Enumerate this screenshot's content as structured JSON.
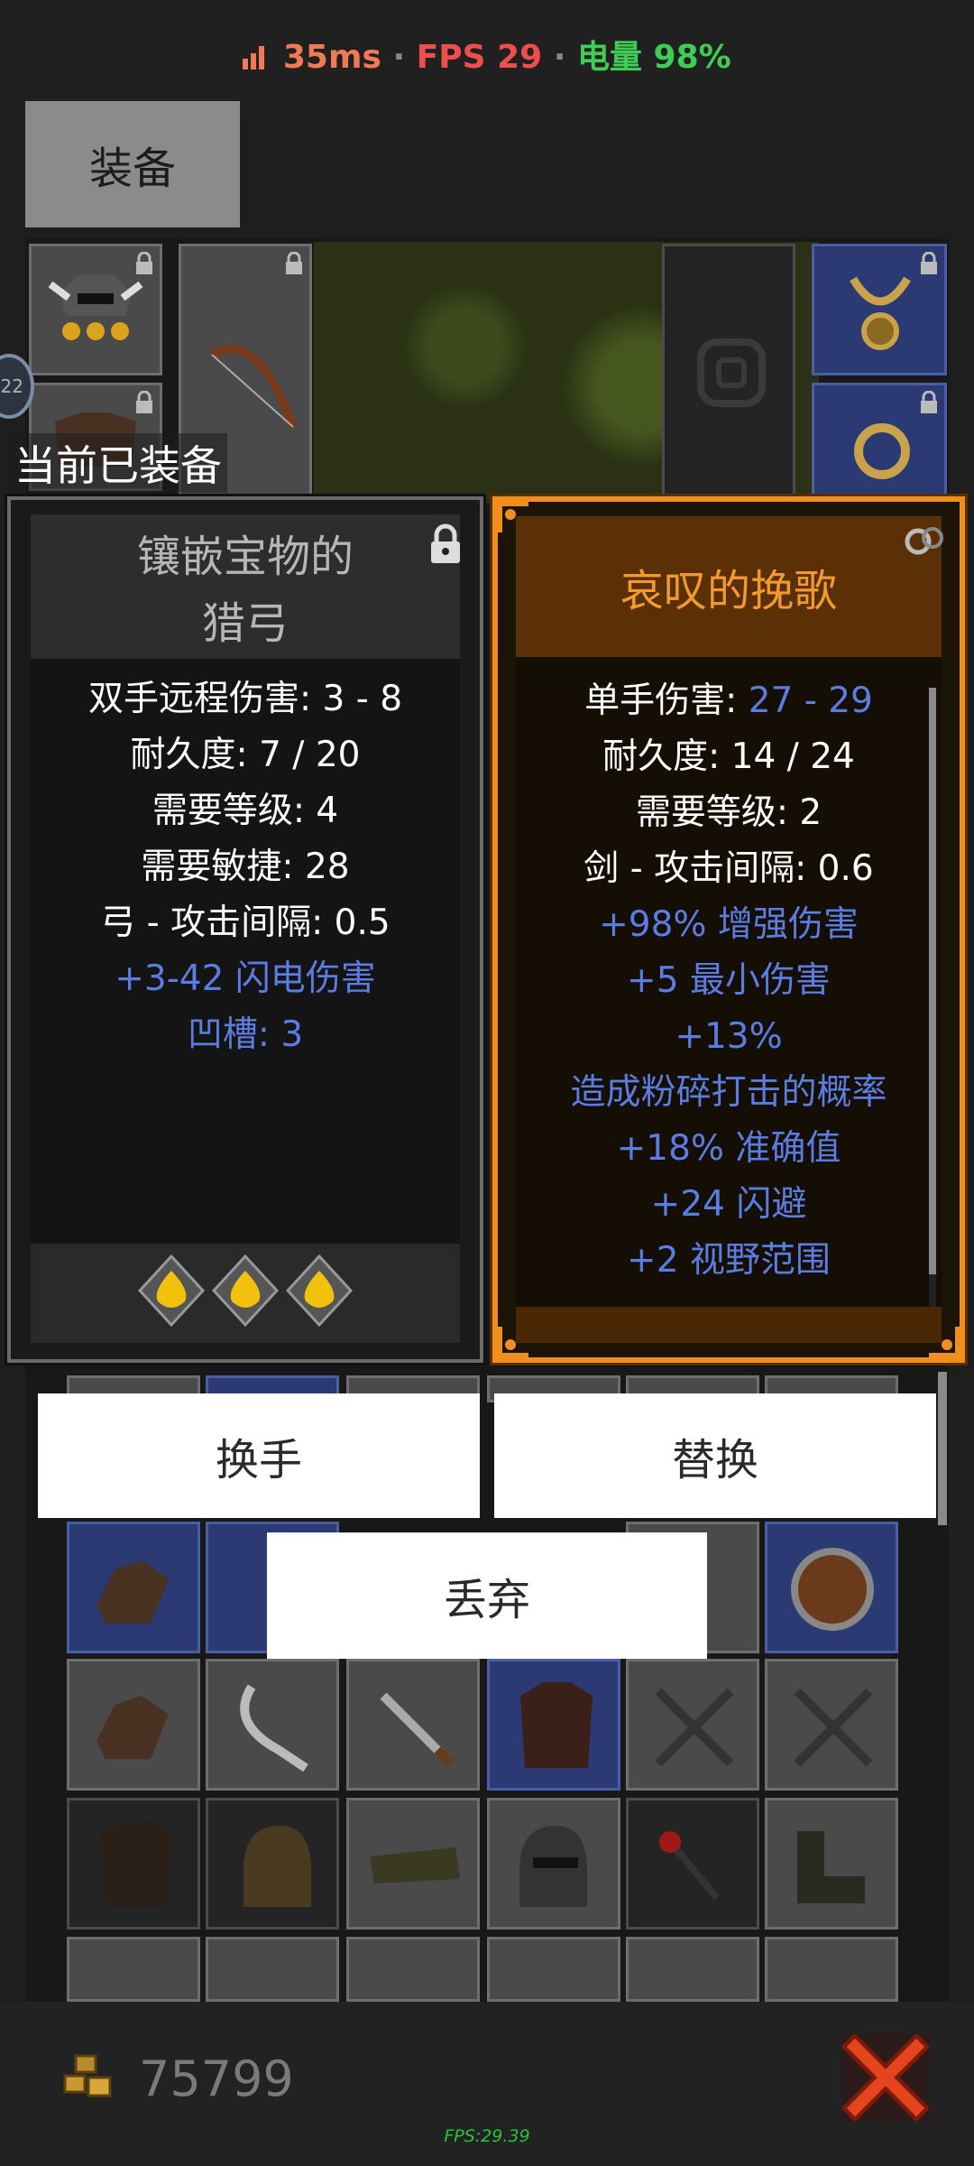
{
  "status": {
    "signal_icon": "signal-bars-icon",
    "latency": "35ms",
    "fps": "FPS 29",
    "battery": "电量 98%",
    "sep": "·",
    "colors": {
      "latency": "#f07a55",
      "fps": "#ee4e4e",
      "battery": "#3fce55"
    }
  },
  "tabs": {
    "equip": "装备"
  },
  "level_badge": "22",
  "equipped_label": "当前已装备",
  "left_item": {
    "title_line1": "镶嵌宝物的",
    "title_line2": "猎弓",
    "stats": [
      "双手远程伤害: 3 - 8",
      "耐久度: 7 / 20",
      "需要等级: 4",
      "需要敏捷: 28",
      "弓 - 攻击间隔: 0.5"
    ],
    "magic": [
      "+3-42 闪电伤害",
      "凹槽: 3"
    ],
    "socket_count": 3
  },
  "right_item": {
    "title": "哀叹的挽歌",
    "damage_label": "单手伤害: ",
    "damage_value": "27 - 29",
    "stats": [
      "耐久度: 14 / 24",
      "需要等级: 2",
      "剑 - 攻击间隔: 0.6"
    ],
    "magic": [
      "+98% 增强伤害",
      "+5 最小伤害",
      "+13%",
      "造成粉碎打击的概率",
      "+18% 准确值",
      "+24 闪避",
      "+2 视野范围"
    ],
    "rarity_color": "#f08f1e"
  },
  "buttons": {
    "swap_hand": "换手",
    "replace": "替换",
    "discard": "丢弃"
  },
  "gold": "75799",
  "fps_small": "FPS:29.39"
}
